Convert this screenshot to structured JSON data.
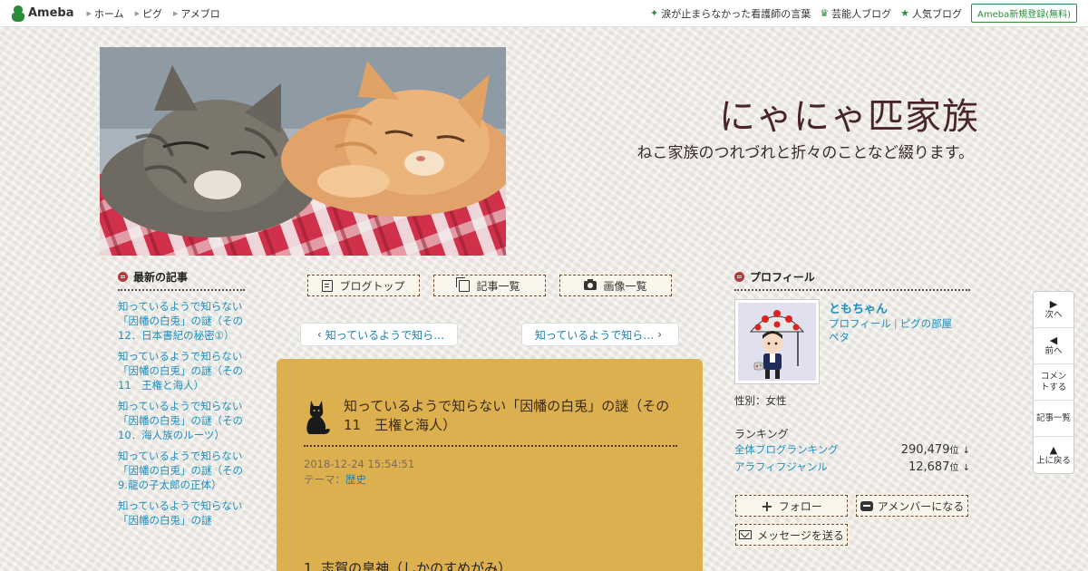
{
  "topbar": {
    "logo": "Ameba",
    "nav": [
      "ホーム",
      "ピグ",
      "アメブロ"
    ],
    "right_links": [
      {
        "icon": "sparkle-icon",
        "label": "涙が止まらなかった看護師の言葉"
      },
      {
        "icon": "crown-icon",
        "label": "芸能人ブログ"
      },
      {
        "icon": "star-icon",
        "label": "人気ブログ"
      }
    ],
    "register": "Ameba新規登録(無料)"
  },
  "header": {
    "title": "にゃにゃ匹家族",
    "description": "ねこ家族のつれづれと折々のことなど綴ります。"
  },
  "recent": {
    "heading": "最新の記事",
    "items": [
      "知っているようで知らない「因幡の白兎」の謎（その12．日本書紀の秘密①）",
      "知っているようで知らない「因幡の白兎」の謎（その11　王権と海人）",
      "知っているようで知らない「因幡の白兎」の謎（その10．海人族のルーツ）",
      "知っているようで知らない「因幡の白兎」の謎（その9.龍の子太郎の正体）",
      "知っているようで知らない「因幡の白兎」の謎"
    ]
  },
  "nav_buttons": {
    "blog_top": "ブログトップ",
    "entries": "記事一覧",
    "images": "画像一覧"
  },
  "pager": {
    "prev": "知っているようで知ら…",
    "next": "知っているようで知ら…"
  },
  "article": {
    "title": "知っているようで知らない「因幡の白兎」の謎（その11　王権と海人）",
    "date": "2018-12-24 15:54:51",
    "theme_label": "テーマ：",
    "theme": "歴史",
    "body_heading": "1. 志賀の皇神（しかのすめがみ）"
  },
  "profile": {
    "heading": "プロフィール",
    "name": "ともちゃん",
    "link_profile": "プロフィール",
    "link_pigg": "ピグの部屋",
    "link_peta": "ペタ",
    "gender": "性別：女性",
    "ranking_label": "ランキング",
    "rankings": [
      {
        "name": "全体ブログランキング",
        "value": "290,479",
        "unit": "位",
        "trend": "↓"
      },
      {
        "name": "アラフィフジャンル",
        "value": "12,687",
        "unit": "位",
        "trend": "↓"
      }
    ],
    "follow": "フォロー",
    "amember": "アメンバーになる",
    "message": "メッセージを送る"
  },
  "float_menu": {
    "next": "次へ",
    "prev": "前へ",
    "comment": "コメントする",
    "entries": "記事一覧",
    "top": "上に戻る"
  },
  "colors": {
    "accent_green": "#2d8c3c",
    "link_blue": "#1e8fc0",
    "article_bg": "#ddb04f",
    "title_brown": "#4a2525"
  }
}
